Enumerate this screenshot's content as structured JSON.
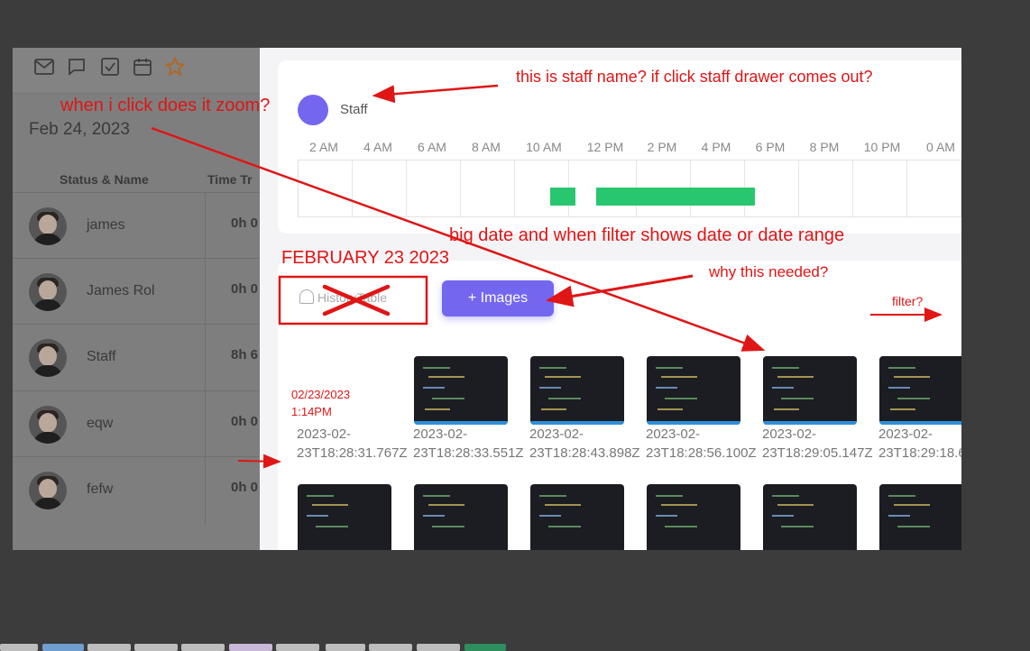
{
  "left_panel": {
    "top_icons": [
      "mail-icon",
      "chat-icon",
      "checkbox-icon",
      "calendar-icon",
      "star-icon"
    ],
    "date": "Feb 24, 2023",
    "columns": [
      "Status & Name",
      "Time Tr"
    ],
    "rows": [
      {
        "name": "james",
        "time": "0h 0"
      },
      {
        "name": "James Rol",
        "time": "0h 0"
      },
      {
        "name": "Staff",
        "time": "8h 6"
      },
      {
        "name": "eqw",
        "time": "0h 0"
      },
      {
        "name": "fefw",
        "time": "0h 0"
      }
    ]
  },
  "drawer": {
    "staff_name": "Staff",
    "timeline_ticks": [
      "2 AM",
      "4 AM",
      "6 AM",
      "8 AM",
      "10 AM",
      "12 PM",
      "2 PM",
      "4 PM",
      "6 PM",
      "8 PM",
      "10 PM",
      "0 AM"
    ],
    "history_tab": "HistoryTable",
    "images_button": "+ Images",
    "thumbnails_row1": [
      {
        "caption": "2023-02-23T18:28:31.767Z",
        "has_image": false
      },
      {
        "caption": "2023-02-23T18:28:33.551Z",
        "has_image": true
      },
      {
        "caption": "2023-02-23T18:28:43.898Z",
        "has_image": true
      },
      {
        "caption": "2023-02-23T18:28:56.100Z",
        "has_image": true
      },
      {
        "caption": "2023-02-23T18:29:05.147Z",
        "has_image": true
      },
      {
        "caption": "2023-02-23T18:29:18.6",
        "has_image": true
      }
    ]
  },
  "annotations": {
    "staff_note": "this is staff name? if click staff drawer comes out?",
    "zoom_note": "when i click does it zoom?",
    "big_date_note": "big date and when filter shows date or date range",
    "date_heading": "FEBRUARY 23 2023",
    "why_note": "why this needed?",
    "filter_note": "filter?",
    "timestamp_date": "02/23/2023",
    "timestamp_time": "1:14PM"
  },
  "colors": {
    "accent": "#7367f0",
    "bar": "#28c76f",
    "annotation": "#e01515"
  }
}
